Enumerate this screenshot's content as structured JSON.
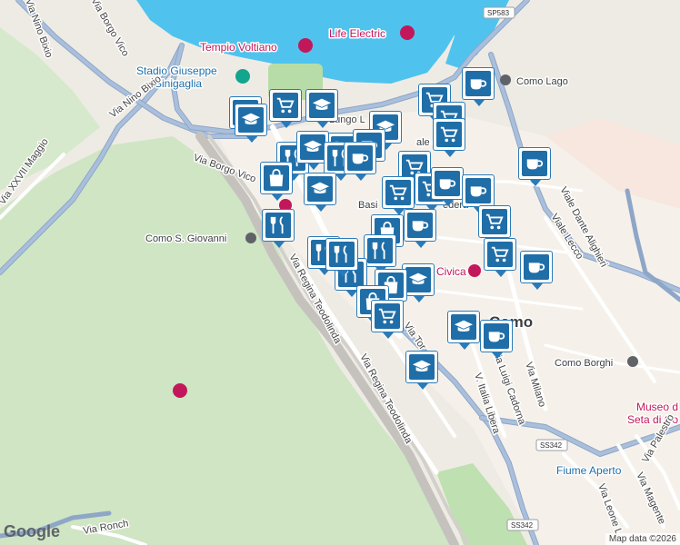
{
  "labels": {
    "tempio": "Tempio Voltiano",
    "life_electric": "Life Electric",
    "stadio": "Stadio Giuseppe",
    "stadio2": "Sinigaglia",
    "como_lago": "Como Lago",
    "como_s_giovanni": "Como S. Giovanni",
    "como": "Como",
    "como_borghi": "Como Borghi",
    "museo": "Museo d",
    "museo2": "Seta di Co",
    "fiume": "Fiume Aperto",
    "via_nino_bixio": "Via Nino Bixio",
    "via_nino_bixio_top": "Via Nino Bixio",
    "via_borgo_vico": "Via Borgo Vico",
    "via_borgo_vico2": "Via Borgo Vico",
    "via_xxvii": "Via XXVII Maggio",
    "via_regina1": "Via Regina Teodolinda",
    "via_regina2": "Via Regina Teodolinda",
    "lungo": "Lungo L",
    "viale_lecco": "Viale Lecco",
    "viale_dante": "Viale Dante Alighieri",
    "via_milano": "Via Milano",
    "via_cadorna": "Via Luigi Cadorna",
    "italia_libera": "V. Italia Libera",
    "via_leone": "Via Leone L",
    "via_magenta": "Via Magente",
    "via_palestro": "Via Palestro",
    "via_ronch": "Via Ronch",
    "via_tor": "Via Tor",
    "civica": "Civica",
    "basilica": "Basi",
    "federa": "edera",
    "viale_di": "ale di S"
  },
  "shields": {
    "sp583": "SP583",
    "ss342a": "SS342",
    "ss342b": "SS342"
  },
  "markers": [
    {
      "icon": "education-icon"
    },
    {
      "icon": "education-icon"
    },
    {
      "icon": "shopping-cart-icon"
    },
    {
      "icon": "education-icon"
    },
    {
      "icon": "shopping-cart-icon"
    },
    {
      "icon": "coffee-icon"
    },
    {
      "icon": "shopping-cart-icon"
    },
    {
      "icon": "education-icon"
    },
    {
      "icon": "shopping-cart-icon"
    },
    {
      "icon": "shopping-cart-icon"
    },
    {
      "icon": "restaurant-icon"
    },
    {
      "icon": "education-icon"
    },
    {
      "icon": "restaurant-icon"
    },
    {
      "icon": "coffee-icon"
    },
    {
      "icon": "coffee-icon"
    },
    {
      "icon": "shopping-bag-icon"
    },
    {
      "icon": "education-icon"
    },
    {
      "icon": "shopping-cart-icon"
    },
    {
      "icon": "shopping-cart-icon"
    },
    {
      "icon": "coffee-icon"
    },
    {
      "icon": "coffee-icon"
    },
    {
      "icon": "restaurant-icon"
    },
    {
      "icon": "coffee-icon"
    },
    {
      "icon": "shopping-cart-icon"
    },
    {
      "icon": "shopping-bag-icon"
    },
    {
      "icon": "restaurant-icon"
    },
    {
      "icon": "restaurant-icon"
    },
    {
      "icon": "restaurant-icon"
    },
    {
      "icon": "shopping-cart-icon"
    },
    {
      "icon": "restaurant-icon"
    },
    {
      "icon": "education-icon"
    },
    {
      "icon": "shopping-bag-icon"
    },
    {
      "icon": "shopping-bag-icon"
    },
    {
      "icon": "shopping-cart-icon"
    },
    {
      "icon": "education-icon"
    },
    {
      "icon": "coffee-icon"
    },
    {
      "icon": "education-icon"
    },
    {
      "icon": "shopping-cart-icon"
    },
    {
      "icon": "coffee-icon"
    },
    {
      "icon": "coffee-icon"
    }
  ],
  "google": "Google",
  "attribution": "Map data ©2026"
}
